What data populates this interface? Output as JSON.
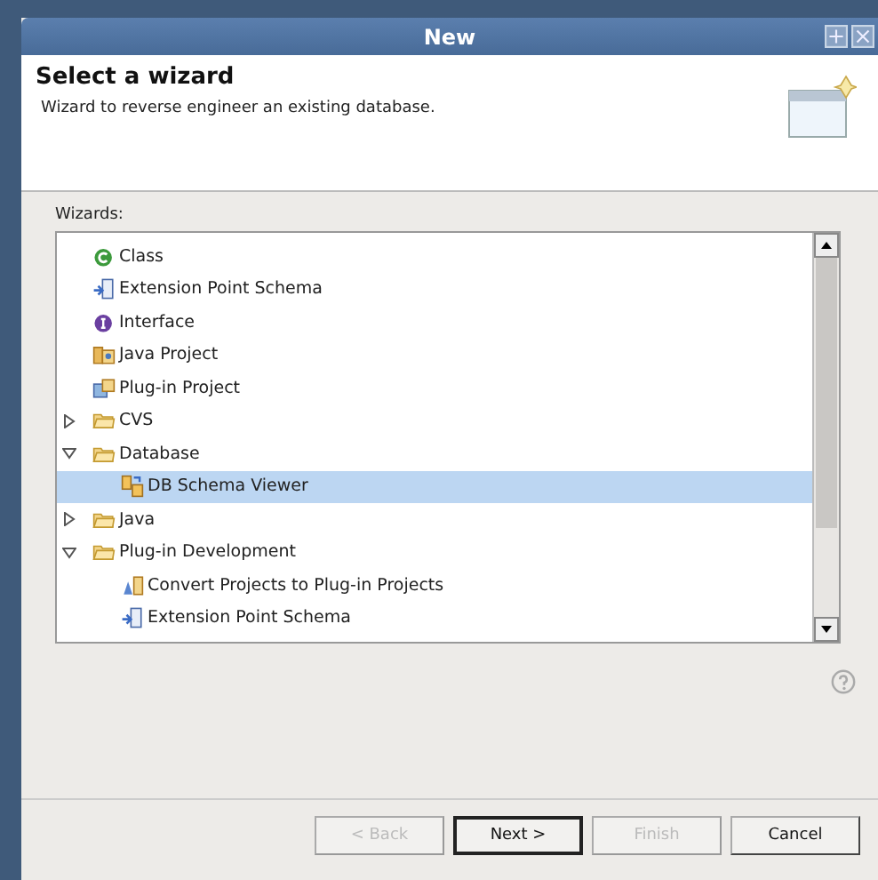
{
  "window": {
    "title": "New"
  },
  "header": {
    "title": "Select a wizard",
    "description": "Wizard to reverse engineer an existing database."
  },
  "wizards": {
    "label": "Wizards:",
    "items": [
      {
        "label": "Class",
        "kind": "class",
        "selected": false
      },
      {
        "label": "Extension Point Schema",
        "kind": "schema",
        "selected": false
      },
      {
        "label": "Interface",
        "kind": "interface",
        "selected": false
      },
      {
        "label": "Java Project",
        "kind": "java-project",
        "selected": false
      },
      {
        "label": "Plug-in Project",
        "kind": "plugin-project",
        "selected": false
      },
      {
        "label": "CVS",
        "kind": "folder",
        "selected": false,
        "expanded": false
      },
      {
        "label": "Database",
        "kind": "folder",
        "selected": false,
        "expanded": true,
        "children": [
          {
            "label": "DB Schema Viewer",
            "kind": "db",
            "selected": true
          }
        ]
      },
      {
        "label": "Java",
        "kind": "folder",
        "selected": false,
        "expanded": false
      },
      {
        "label": "Plug-in Development",
        "kind": "folder",
        "selected": false,
        "expanded": true,
        "children": [
          {
            "label": "Convert Projects to Plug-in Projects",
            "kind": "convert",
            "selected": false
          },
          {
            "label": "Extension Point Schema",
            "kind": "schema",
            "selected": false
          }
        ]
      }
    ]
  },
  "buttons": [
    {
      "label": "< Back",
      "disabled": true,
      "default": false
    },
    {
      "label": "Next >",
      "disabled": false,
      "default": true
    },
    {
      "label": "Finish",
      "disabled": true,
      "default": false
    },
    {
      "label": "Cancel",
      "disabled": false,
      "default": false
    }
  ]
}
